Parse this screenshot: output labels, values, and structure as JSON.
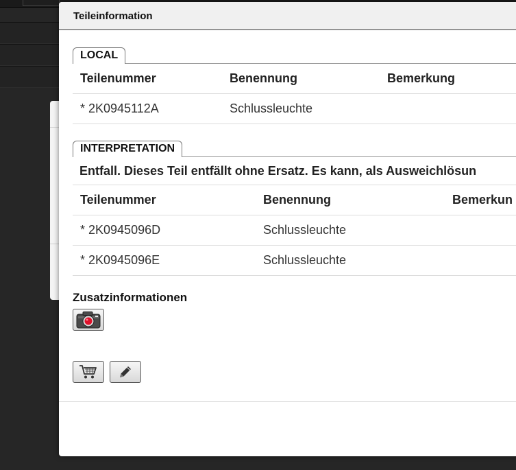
{
  "dialog": {
    "title": "Teileinformation"
  },
  "local": {
    "tab_label": "LOCAL",
    "columns": [
      "Teilenummer",
      "Benennung",
      "Bemerkung"
    ],
    "rows": [
      [
        "* 2K0945112A",
        "Schlussleuchte",
        ""
      ]
    ]
  },
  "interpretation": {
    "tab_label": "INTERPRETATION",
    "note": "Entfall. Dieses Teil entfällt ohne Ersatz. Es kann, als Ausweichlösun",
    "columns": [
      "Teilenummer",
      "Benennung",
      "Bemerkun"
    ],
    "rows": [
      [
        "* 2K0945096D",
        "Schlussleuchte",
        ""
      ],
      [
        "* 2K0945096E",
        "Schlussleuchte",
        ""
      ]
    ]
  },
  "zusatz": {
    "label": "Zusatzinformationen",
    "icons": [
      "camera-icon"
    ]
  },
  "actions": {
    "icons": [
      "cart-icon",
      "pencil-icon"
    ]
  },
  "colors": {
    "camera_lens": "#e0102a",
    "text": "#333333"
  }
}
